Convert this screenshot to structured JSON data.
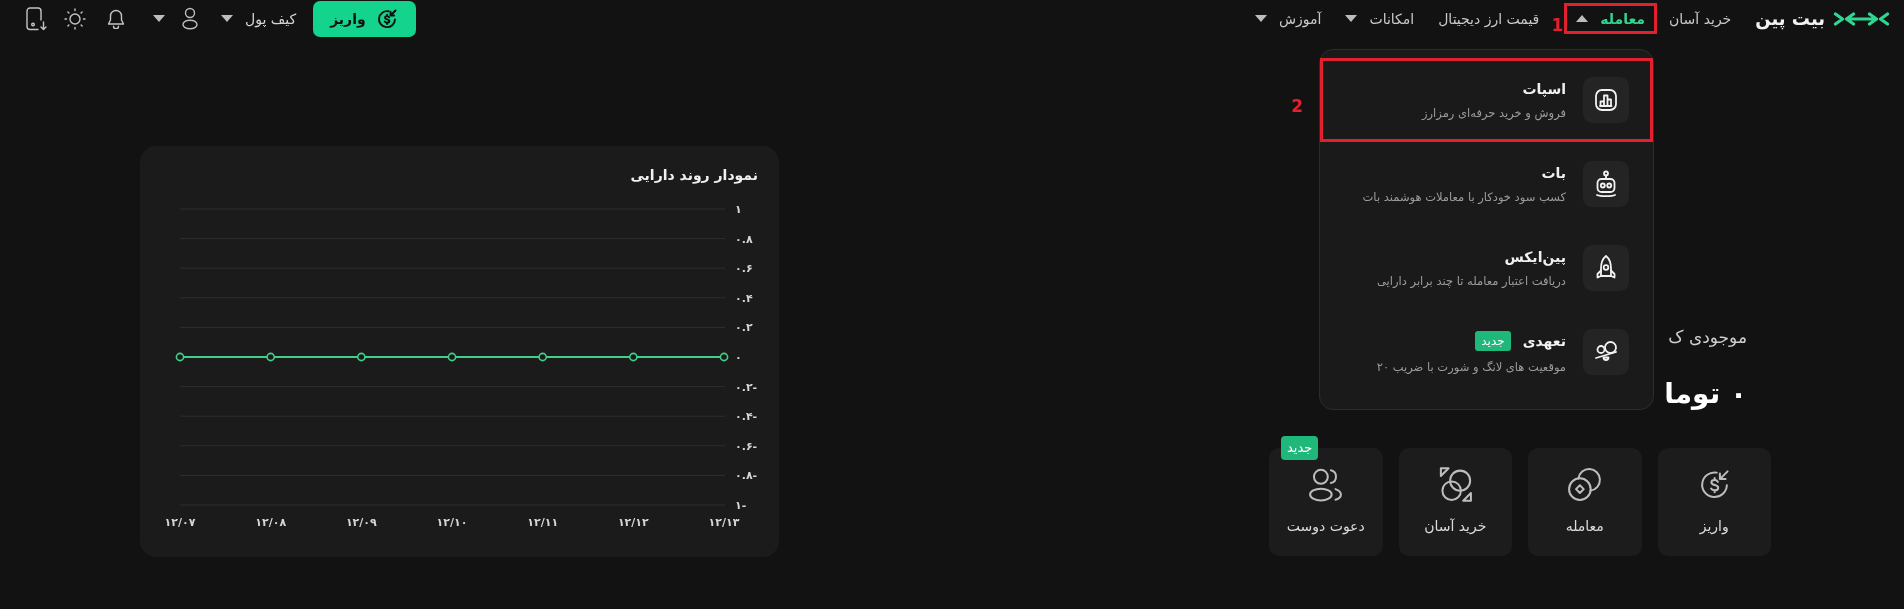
{
  "topbar": {
    "logo": {
      "text": "بیت پین"
    },
    "nav": {
      "items": [
        {
          "kind": "link",
          "label": "خرید آسان",
          "selected": false
        },
        {
          "kind": "menu",
          "label": "معامله",
          "selected": true,
          "expanded": true,
          "annotation": "1",
          "menu": {
            "items": [
              {
                "title": "اسپات",
                "description": "فروش و خرید حرفه‌ای رمزارز",
                "annotation": "2"
              },
              {
                "title": "بات",
                "description": "کسب سود خودکار با معاملات هوشمند بات"
              },
              {
                "title": "پین‌ایکس",
                "description": "دریافت اعتبار معامله تا چند برابر دارایی"
              },
              {
                "title": "تعهدی",
                "badge": "جدید",
                "description": "موقعیت های لانگ و شورت با ضریب ۲۰"
              }
            ]
          }
        },
        {
          "kind": "link",
          "label": "قیمت ارز دیجیتال",
          "selected": false
        },
        {
          "kind": "menu",
          "label": "امکانات",
          "selected": false,
          "expanded": false
        },
        {
          "kind": "menu",
          "label": "آموزش",
          "selected": false,
          "expanded": false
        }
      ]
    },
    "deposit_button": {
      "label": "واریز"
    },
    "wallet_menu": {
      "label": "کیف پول"
    }
  },
  "chart_card": {
    "chart_data": {
      "type": "line",
      "title": "نمودار روند دارایی",
      "grid": true,
      "categories": [
        "۱۲/۰۷",
        "۱۲/۰۸",
        "۱۲/۰۹",
        "۱۲/۱۰",
        "۱۲/۱۱",
        "۱۲/۱۲",
        "۱۲/۱۳"
      ],
      "series": [
        {
          "color": "#41d08a",
          "marker": "circle",
          "values": [
            0,
            0,
            0,
            0,
            0,
            0,
            0
          ]
        }
      ],
      "ylim": [
        -1,
        1
      ],
      "yticks": [
        {
          "value": 1,
          "label": "۱"
        },
        {
          "value": 0.8,
          "label": "۰.۸"
        },
        {
          "value": 0.6,
          "label": "۰.۶"
        },
        {
          "value": 0.4,
          "label": "۰.۴"
        },
        {
          "value": 0.2,
          "label": "۰.۲"
        },
        {
          "value": 0,
          "label": "۰"
        },
        {
          "value": -0.2,
          "label": "۰.۲-"
        },
        {
          "value": -0.4,
          "label": "۰.۴-"
        },
        {
          "value": -0.6,
          "label": "۰.۶-"
        },
        {
          "value": -0.8,
          "label": "۰.۸-"
        },
        {
          "value": -1,
          "label": "۱-"
        }
      ]
    }
  },
  "balance": {
    "label": "موجودی ک",
    "amount": "۰ توما"
  },
  "quick_actions": [
    {
      "label": "واریز"
    },
    {
      "label": "معامله"
    },
    {
      "label": "خرید آسان"
    },
    {
      "label": "دعوت دوست",
      "badge": "جدید"
    }
  ]
}
